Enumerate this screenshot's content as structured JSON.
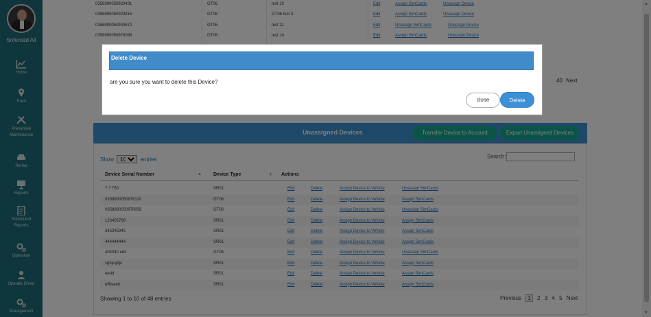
{
  "user": {
    "name": "Soferoad All"
  },
  "sidebar": {
    "items": [
      {
        "label": "Home",
        "icon": "chart-icon"
      },
      {
        "label": "Track",
        "icon": "pin-icon"
      },
      {
        "label": "Prevantive",
        "label2": "Maintenance",
        "icon": "tools-icon"
      },
      {
        "label": "Rental",
        "icon": "car-icon"
      },
      {
        "label": "Reports",
        "icon": "board-icon"
      },
      {
        "label": "Scheduled",
        "label2": "Reports",
        "icon": "clipboard-icon"
      },
      {
        "label": "Operation",
        "icon": "gears-icon"
      },
      {
        "label": "Operate Driver",
        "icon": "driver-icon"
      },
      {
        "label": "Management",
        "icon": "gears-icon"
      }
    ]
  },
  "top_table": {
    "rows": [
      {
        "serial": "0358890050920431",
        "type": "GT06",
        "name": "test 10",
        "actions": [
          "Edit",
          "Assign SimCards",
          "Unassign Device"
        ]
      },
      {
        "serial": "0358890050923815",
        "type": "GT06",
        "name": "GT06 test 3",
        "actions": [
          "Edit",
          "Assign SimCards",
          "Unassign Device"
        ]
      },
      {
        "serial": "0358890050943672",
        "type": "GT06",
        "name": "test 11",
        "actions": [
          "Edit",
          "Unassign SimCards",
          "Unassign Device"
        ]
      },
      {
        "serial": "0358890050979098",
        "type": "GT06",
        "name": "test 14",
        "actions": [
          "Edit",
          "Assign SimCards",
          "Unassign Device"
        ]
      }
    ],
    "pager_page": "40",
    "pager_next": "Next"
  },
  "modal": {
    "title": "Delete Device",
    "message": "are you sure you want to delete this Device?",
    "close_label": "close",
    "delete_label": "Delete"
  },
  "unassigned": {
    "title": "Unassigned Devices",
    "transfer_label": "Transfer Device to Account",
    "export_label": "Export Unassigned Devices",
    "show_label": "Show",
    "entries_label": "entries",
    "page_size": "10",
    "search_label": "Search:",
    "columns": [
      "Device Serial Number",
      "Device Type",
      "Actions"
    ],
    "rows": [
      {
        "serial": "? ? 750",
        "type": "SR01",
        "actions": [
          "Edit",
          "Delete",
          "Assign Device to Vehicle",
          "Unassign SimCards"
        ]
      },
      {
        "serial": "0358890050876120",
        "type": "GT06",
        "actions": [
          "Edit",
          "Delete",
          "Assign Device to Vehicle",
          "Assign SimCards"
        ]
      },
      {
        "serial": "0358890050978058",
        "type": "GT06",
        "actions": [
          "Edit",
          "Delete",
          "Assign Device to Vehicle",
          "Unassign SimCards"
        ]
      },
      {
        "serial": "123456789",
        "type": "SR01",
        "actions": [
          "Edit",
          "Delete",
          "Assign Device to Vehicle",
          "Assign SimCards"
        ]
      },
      {
        "serial": "345345345",
        "type": "SR01",
        "actions": [
          "Edit",
          "Delete",
          "Assign Device to Vehicle",
          "Assign SimCards"
        ]
      },
      {
        "serial": "444444444",
        "type": "SR01",
        "actions": [
          "Edit",
          "Delete",
          "Assign Device to Vehicle",
          "Assign SimCards"
        ]
      },
      {
        "serial": "404040 edit",
        "type": "GT06",
        "actions": [
          "Edit",
          "Delete",
          "Assign Device to Vehicle",
          "Unassign SimCards"
        ]
      },
      {
        "serial": "cghjcghjc",
        "type": "SR01",
        "actions": [
          "Edit",
          "Delete",
          "Assign Device to Vehicle",
          "Assign SimCards"
        ]
      },
      {
        "serial": "eedd",
        "type": "SR01",
        "actions": [
          "Edit",
          "Delete",
          "Assign Device to Vehicle",
          "Assign SimCards"
        ]
      },
      {
        "serial": "eRwaetr",
        "type": "SR01",
        "actions": [
          "Edit",
          "Delete",
          "Assign Device to Vehicle",
          "Assign SimCards"
        ]
      }
    ],
    "info": "Showing 1 to 10 of 48 entries",
    "pager": {
      "previous": "Previous",
      "pages": [
        "1",
        "2",
        "3",
        "4",
        "5"
      ],
      "next": "Next"
    }
  }
}
